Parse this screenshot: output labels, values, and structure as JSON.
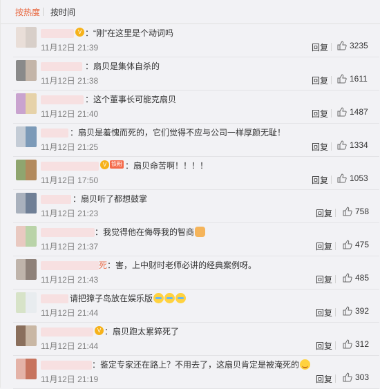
{
  "tabs": {
    "hot": "按热度",
    "time": "按时间"
  },
  "reply_label": "回复",
  "comments": [
    {
      "text": "：“刚”在这里是个动词吗",
      "date": "11月12日 21:39",
      "likes": "3235"
    },
    {
      "text": "：扇贝是集体自杀的",
      "date": "11月12日 21:38",
      "likes": "1611"
    },
    {
      "text": "：这个董事长可能克扇贝",
      "date": "11月12日 21:40",
      "likes": "1487"
    },
    {
      "text": "：扇贝是羞愧而死的，它们觉得不应与公司一样厚颜无耻！",
      "date": "11月12日 21:25",
      "likes": "1334"
    },
    {
      "badge": "铁粉",
      "text": "：扇贝命苦啊！！！！",
      "date": "11月12日 17:50",
      "likes": "1053"
    },
    {
      "text": "：扇贝听了都想鼓掌 ",
      "date": "11月12日 21:23",
      "likes": "758"
    },
    {
      "text": "：我觉得他在侮辱我的智商",
      "date": "11月12日 21:37",
      "likes": "475"
    },
    {
      "name_tail": "死",
      "text": "：害，上中财时老师必讲的经典案例呀。",
      "date": "11月12日 21:43",
      "likes": "485"
    },
    {
      "text": "请把獐子岛放在娱乐版",
      "date": "11月12日 21:44",
      "likes": "392"
    },
    {
      "text": "：扇贝跑太累猝死了",
      "date": "11月12日 21:44",
      "likes": "312"
    },
    {
      "text": "：鉴定专家还在路上？不用去了，这扇贝肯定是被淹死的",
      "date": "11月12日 21:19",
      "likes": "303"
    }
  ]
}
